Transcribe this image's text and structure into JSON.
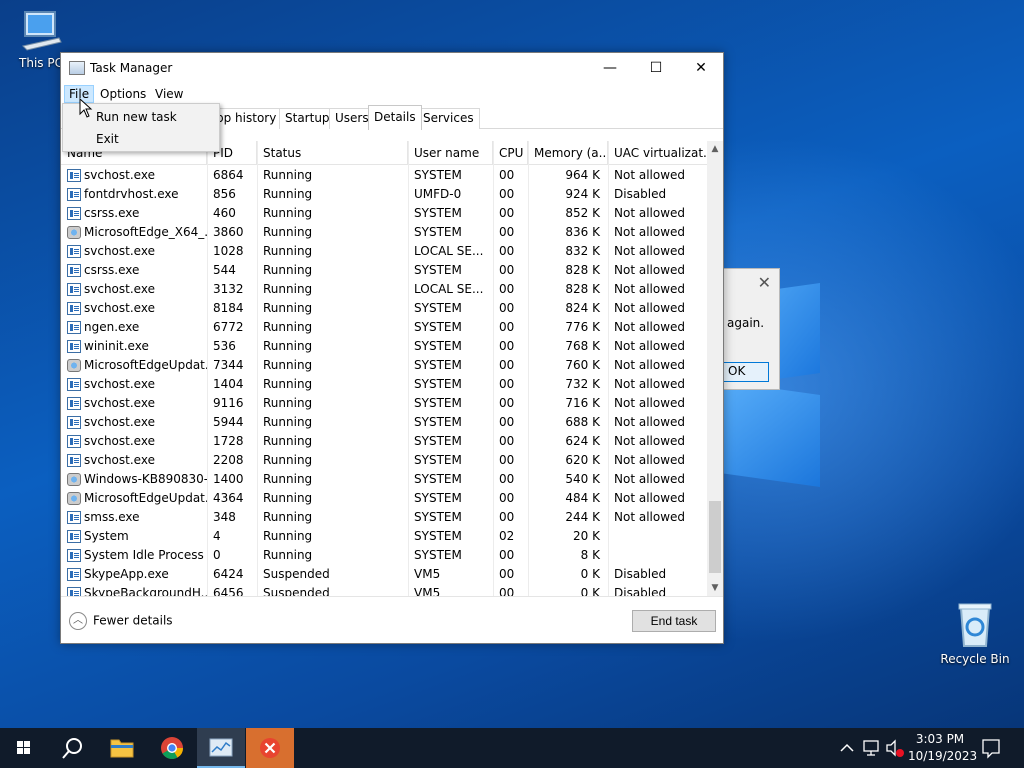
{
  "desktop": {
    "icons": [
      {
        "label": "This PC"
      },
      {
        "label": "Recycle Bin"
      }
    ]
  },
  "bg_dialog": {
    "message": "again.",
    "ok_label": "OK"
  },
  "window": {
    "title": "Task Manager",
    "controls": {
      "minimize": "—",
      "maximize": "☐",
      "close": "✕"
    }
  },
  "menu": {
    "file": "File",
    "options": "Options",
    "view": "View"
  },
  "file_menu": {
    "items": [
      "Run new task",
      "Exit"
    ]
  },
  "tabs": [
    "pp history",
    "Startup",
    "Users",
    "Details",
    "Services"
  ],
  "selected_tab": "Details",
  "columns": {
    "name": "Name",
    "pid": "PID",
    "status": "Status",
    "user": "User name",
    "cpu": "CPU",
    "memory": "Memory (a...",
    "uac": "UAC virtualizat..."
  },
  "rows": [
    {
      "name": "svchost.exe",
      "pid": "6864",
      "status": "Running",
      "user": "SYSTEM",
      "cpu": "00",
      "mem": "964 K",
      "uac": "Not allowed",
      "icon": "svc"
    },
    {
      "name": "fontdrvhost.exe",
      "pid": "856",
      "status": "Running",
      "user": "UMFD-0",
      "cpu": "00",
      "mem": "924 K",
      "uac": "Disabled",
      "icon": "svc"
    },
    {
      "name": "csrss.exe",
      "pid": "460",
      "status": "Running",
      "user": "SYSTEM",
      "cpu": "00",
      "mem": "852 K",
      "uac": "Not allowed",
      "icon": "svc"
    },
    {
      "name": "MicrosoftEdge_X64_...",
      "pid": "3860",
      "status": "Running",
      "user": "SYSTEM",
      "cpu": "00",
      "mem": "836 K",
      "uac": "Not allowed",
      "icon": "edge"
    },
    {
      "name": "svchost.exe",
      "pid": "1028",
      "status": "Running",
      "user": "LOCAL SE...",
      "cpu": "00",
      "mem": "832 K",
      "uac": "Not allowed",
      "icon": "svc"
    },
    {
      "name": "csrss.exe",
      "pid": "544",
      "status": "Running",
      "user": "SYSTEM",
      "cpu": "00",
      "mem": "828 K",
      "uac": "Not allowed",
      "icon": "svc"
    },
    {
      "name": "svchost.exe",
      "pid": "3132",
      "status": "Running",
      "user": "LOCAL SE...",
      "cpu": "00",
      "mem": "828 K",
      "uac": "Not allowed",
      "icon": "svc"
    },
    {
      "name": "svchost.exe",
      "pid": "8184",
      "status": "Running",
      "user": "SYSTEM",
      "cpu": "00",
      "mem": "824 K",
      "uac": "Not allowed",
      "icon": "svc"
    },
    {
      "name": "ngen.exe",
      "pid": "6772",
      "status": "Running",
      "user": "SYSTEM",
      "cpu": "00",
      "mem": "776 K",
      "uac": "Not allowed",
      "icon": "svc"
    },
    {
      "name": "wininit.exe",
      "pid": "536",
      "status": "Running",
      "user": "SYSTEM",
      "cpu": "00",
      "mem": "768 K",
      "uac": "Not allowed",
      "icon": "svc"
    },
    {
      "name": "MicrosoftEdgeUpdat...",
      "pid": "7344",
      "status": "Running",
      "user": "SYSTEM",
      "cpu": "00",
      "mem": "760 K",
      "uac": "Not allowed",
      "icon": "edge"
    },
    {
      "name": "svchost.exe",
      "pid": "1404",
      "status": "Running",
      "user": "SYSTEM",
      "cpu": "00",
      "mem": "732 K",
      "uac": "Not allowed",
      "icon": "svc"
    },
    {
      "name": "svchost.exe",
      "pid": "9116",
      "status": "Running",
      "user": "SYSTEM",
      "cpu": "00",
      "mem": "716 K",
      "uac": "Not allowed",
      "icon": "svc"
    },
    {
      "name": "svchost.exe",
      "pid": "5944",
      "status": "Running",
      "user": "SYSTEM",
      "cpu": "00",
      "mem": "688 K",
      "uac": "Not allowed",
      "icon": "svc"
    },
    {
      "name": "svchost.exe",
      "pid": "1728",
      "status": "Running",
      "user": "SYSTEM",
      "cpu": "00",
      "mem": "624 K",
      "uac": "Not allowed",
      "icon": "svc"
    },
    {
      "name": "svchost.exe",
      "pid": "2208",
      "status": "Running",
      "user": "SYSTEM",
      "cpu": "00",
      "mem": "620 K",
      "uac": "Not allowed",
      "icon": "svc"
    },
    {
      "name": "Windows-KB890830-...",
      "pid": "1400",
      "status": "Running",
      "user": "SYSTEM",
      "cpu": "00",
      "mem": "540 K",
      "uac": "Not allowed",
      "icon": "edge"
    },
    {
      "name": "MicrosoftEdgeUpdat...",
      "pid": "4364",
      "status": "Running",
      "user": "SYSTEM",
      "cpu": "00",
      "mem": "484 K",
      "uac": "Not allowed",
      "icon": "edge"
    },
    {
      "name": "smss.exe",
      "pid": "348",
      "status": "Running",
      "user": "SYSTEM",
      "cpu": "00",
      "mem": "244 K",
      "uac": "Not allowed",
      "icon": "svc"
    },
    {
      "name": "System",
      "pid": "4",
      "status": "Running",
      "user": "SYSTEM",
      "cpu": "02",
      "mem": "20 K",
      "uac": "",
      "icon": "svc"
    },
    {
      "name": "System Idle Process",
      "pid": "0",
      "status": "Running",
      "user": "SYSTEM",
      "cpu": "00",
      "mem": "8 K",
      "uac": "",
      "icon": "svc"
    },
    {
      "name": "SkypeApp.exe",
      "pid": "6424",
      "status": "Suspended",
      "user": "VM5",
      "cpu": "00",
      "mem": "0 K",
      "uac": "Disabled",
      "icon": "svc"
    },
    {
      "name": "SkypeBackgroundH...",
      "pid": "6456",
      "status": "Suspended",
      "user": "VM5",
      "cpu": "00",
      "mem": "0 K",
      "uac": "Disabled",
      "icon": "svc"
    }
  ],
  "footer": {
    "fewer_details": "Fewer details",
    "end_task": "End task"
  },
  "taskbar": {
    "time": "3:03 PM",
    "date": "10/19/2023"
  }
}
